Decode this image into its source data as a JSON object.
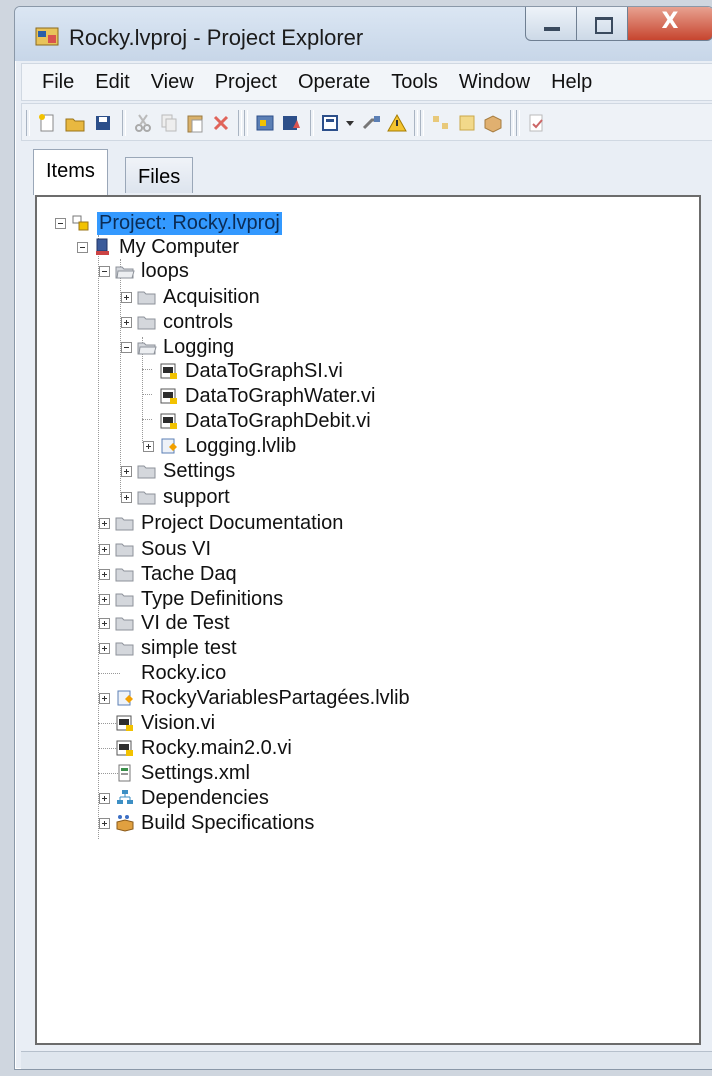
{
  "window": {
    "title": "Rocky.lvproj - Project Explorer",
    "close_glyph": "X"
  },
  "menubar": {
    "items": [
      "File",
      "Edit",
      "View",
      "Project",
      "Operate",
      "Tools",
      "Window",
      "Help"
    ]
  },
  "tabs": {
    "items_label": "Items",
    "files_label": "Files",
    "active": "Items"
  },
  "tree": {
    "project": "Project: Rocky.lvproj",
    "my_computer": "My Computer",
    "loops": "loops",
    "acquisition": "Acquisition",
    "controls": "controls",
    "logging": "Logging",
    "vi_si": "DataToGraphSI.vi",
    "vi_water": "DataToGraphWater.vi",
    "vi_debit": "DataToGraphDebit.vi",
    "logging_lib": "Logging.lvlib",
    "settings": "Settings",
    "support": "support",
    "project_doc": "Project Documentation",
    "sous_vi": "Sous VI",
    "tache_daq": "Tache Daq",
    "type_defs": "Type Definitions",
    "vi_de_test": "VI de Test",
    "simple_test": "simple test",
    "rocky_ico": "Rocky.ico",
    "rocky_lib": "RockyVariablesPartagées.lvlib",
    "vision": "Vision.vi",
    "rocky_main": "Rocky.main2.0.vi",
    "settings_xml": "Settings.xml",
    "dependencies": "Dependencies",
    "build_specs": "Build Specifications"
  },
  "colors": {
    "selection": "#3399ff",
    "folder": "#c8ccd2",
    "close_button": "#c7452f"
  }
}
